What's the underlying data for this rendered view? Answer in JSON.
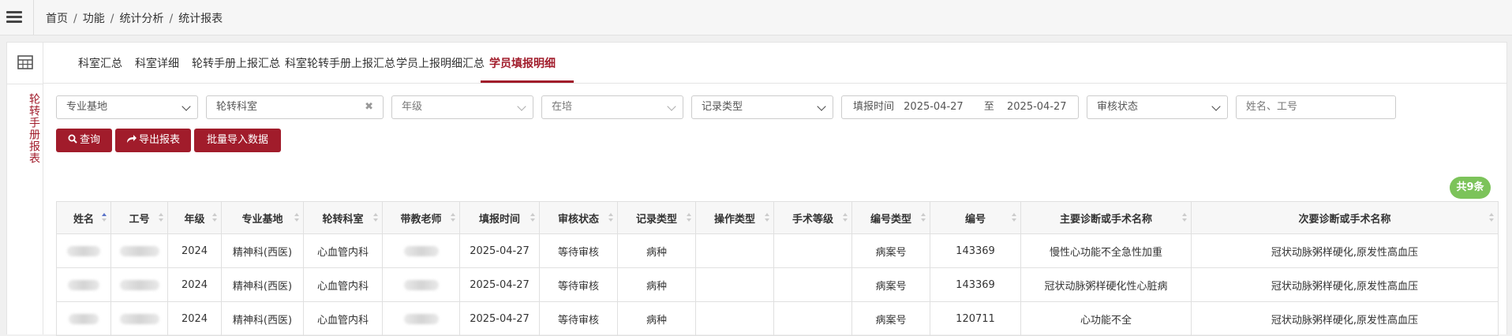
{
  "breadcrumb": [
    "首页",
    "功能",
    "统计分析",
    "统计报表"
  ],
  "side_title": "轮转手册报表",
  "tabs": [
    {
      "label": "科室汇总"
    },
    {
      "label": "科室详细"
    },
    {
      "label": "轮转手册上报汇总"
    },
    {
      "label": "科室轮转手册上报汇总"
    },
    {
      "label": "学员上报明细汇总"
    },
    {
      "label": "学员填报明细",
      "active": true
    }
  ],
  "filters": {
    "base": "专业基地",
    "dept": "轮转科室",
    "grade": "年级",
    "status": "在培",
    "record_type": "记录类型",
    "date_label": "填报时间",
    "date_from": "2025-04-27",
    "date_to_label": "至",
    "date_to": "2025-04-27",
    "audit_status": "审核状态",
    "name_placeholder": "姓名、工号"
  },
  "buttons": {
    "query": "查询",
    "export": "导出报表",
    "import": "批量导入数据"
  },
  "total_badge": "共9条",
  "table": {
    "columns": [
      "姓名",
      "工号",
      "年级",
      "专业基地",
      "轮转科室",
      "带教老师",
      "填报时间",
      "审核状态",
      "记录类型",
      "操作类型",
      "手术等级",
      "编号类型",
      "编号",
      "主要诊断或手术名称",
      "次要诊断或手术名称"
    ],
    "rows": [
      [
        "",
        "",
        "2024",
        "精神科(西医)",
        "心血管内科",
        "",
        "2025-04-27",
        "等待审核",
        "病种",
        "",
        "",
        "病案号",
        "143369",
        "慢性心功能不全急性加重",
        "冠状动脉粥样硬化,原发性高血压"
      ],
      [
        "",
        "",
        "2024",
        "精神科(西医)",
        "心血管内科",
        "",
        "2025-04-27",
        "等待审核",
        "病种",
        "",
        "",
        "病案号",
        "143369",
        "冠状动脉粥样硬化性心脏病",
        "冠状动脉粥样硬化,原发性高血压"
      ],
      [
        "",
        "",
        "2024",
        "精神科(西医)",
        "心血管内科",
        "",
        "2025-04-27",
        "等待审核",
        "病种",
        "",
        "",
        "病案号",
        "120711",
        "心功能不全",
        "冠状动脉粥样硬化,原发性高血压"
      ]
    ]
  }
}
